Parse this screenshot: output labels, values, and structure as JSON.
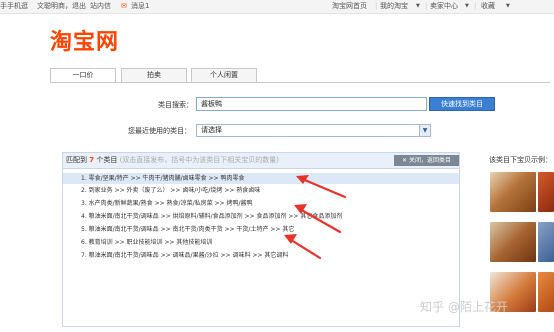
{
  "topbar": {
    "left1": "手手机逛",
    "left2": "文聪明商，退出",
    "left3": "站内信",
    "messages": "消息1",
    "home": "淘宝网首页",
    "my": "我的淘宝",
    "seller": "卖家中心",
    "fav": "收藏"
  },
  "logo": "淘宝网",
  "tabs": [
    "一口价",
    "拍卖",
    "个人闲置"
  ],
  "form": {
    "search_label": "类目搜索：",
    "search_value": "酱板鸭",
    "find_button": "快速找到类目",
    "recent_label": "您最近使用的类目：",
    "recent_value": "请选择"
  },
  "results": {
    "prefix": "匹配到",
    "count": "7",
    "suffix": "个类目",
    "hint": "(双击直接发布，括号中为该类目下相关宝贝的数量)",
    "close_button": "关闭，返回类目",
    "rows": [
      "1.  零食/坚果/特产 >> 牛肉干/猪肉脯/卤味零食 >> 鸭肉零食",
      "2.  到家业务 >> 外卖（废了么） >> 卤味/小吃/烧烤 >> 熟食卤味",
      "3.  水产肉类/新鲜蔬果/熟食 >> 熟食/凉菜/私房菜 >> 烤鸭/酱鸭",
      "4.  粮油米面/南北干货/调味品 >> 烘焙原料/辅料/食品添加剂 >> 食品添加剂 >> 其它食品添加剂",
      "5.  粮油米面/南北干货/调味品 >> 南北干货/肉类干货 >> 干货/土特产 >> 其它",
      "6.  教育培训 >> 职业技能培训 >> 其他技能培训",
      "7.  粮油米面/南北干货/调味品 >> 调味品/果酱/沙拉 >> 调味料 >> 其它调料"
    ]
  },
  "right_head": "该类目下宝贝示例：",
  "watermark": "知乎 @陌上花开",
  "colors": {
    "brand": "#ff4400",
    "accent": "#3b7fd3",
    "arrow": "#e8332a"
  }
}
